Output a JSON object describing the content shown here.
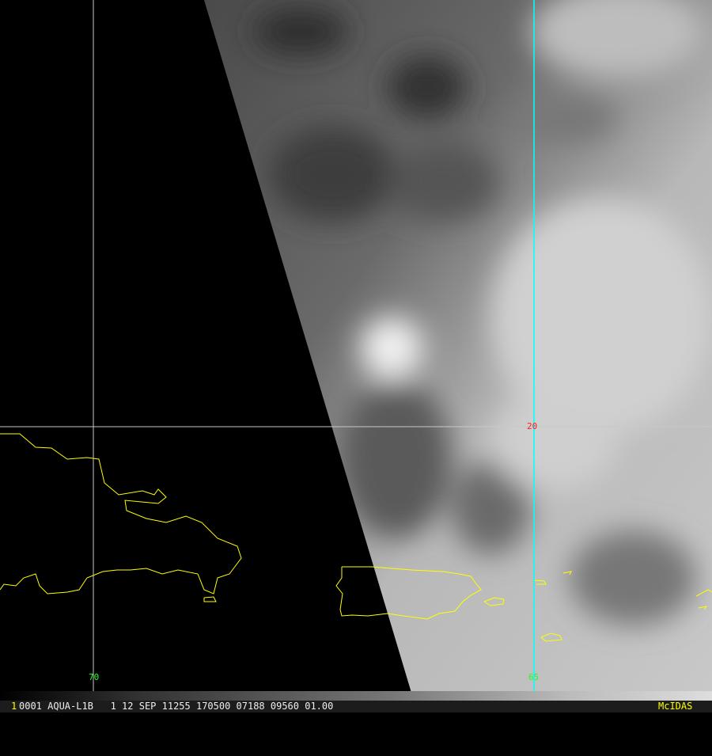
{
  "image": {
    "colors": {
      "coast": "#ffff00",
      "grid": "#c8c8c8",
      "meridian_hl": "#00ffff",
      "lat_label": "#ff2020",
      "lon_label": "#20ff20",
      "status_text": "#ffffff",
      "logo": "#ffff00"
    },
    "grid_labels": {
      "lat_20": "20",
      "lon_70": "70",
      "lon_65": "65"
    }
  },
  "status_bar": {
    "frame_number": "1",
    "info": "0001 AQUA-L1B   1 12 SEP 11255 170500 07188 09560 01.00",
    "logo": "McIDAS"
  }
}
